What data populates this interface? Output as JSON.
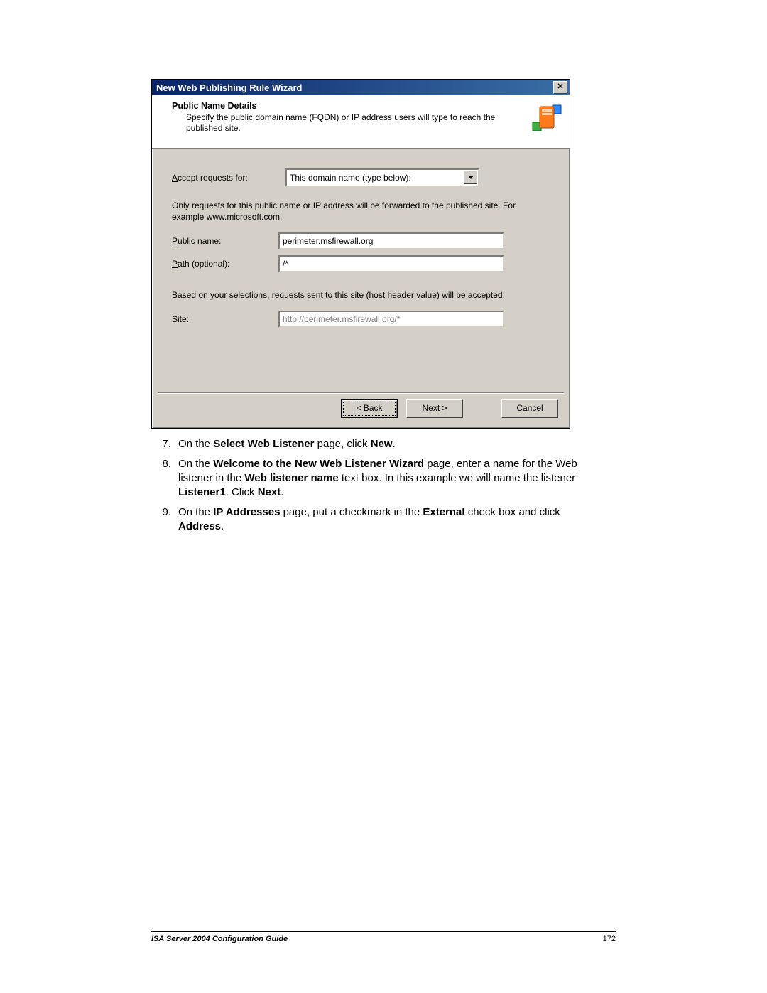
{
  "dialog": {
    "title": "New Web Publishing Rule Wizard",
    "close_x": "✕",
    "heading": "Public Name Details",
    "subhead": "Specify the public domain name (FQDN) or IP address users will type to reach the published site.",
    "accept_label": "Accept requests for:",
    "accept_value": "This domain name (type below):",
    "only_note": "Only requests for this public name or IP address will be forwarded to the published site. For example www.microsoft.com.",
    "public_label": "Public name:",
    "public_value": "perimeter.msfirewall.org",
    "path_label": "Path (optional):",
    "path_value": "/*",
    "based_note": "Based on your selections, requests sent to this site (host header value) will be accepted:",
    "site_label": "Site:",
    "site_value": "http://perimeter.msfirewall.org/*",
    "back_label": "< Back",
    "next_label": "Next >",
    "cancel_label": "Cancel"
  },
  "steps": {
    "s7": {
      "num": "7.",
      "pre": "On the ",
      "b1": "Select Web Listener",
      "mid": " page, click ",
      "b2": "New",
      "post": "."
    },
    "s8": {
      "num": "8.",
      "pre": "On the ",
      "b1": "Welcome to the New Web Listener Wizard",
      "mid": " page, enter a name for the Web listener in the ",
      "b2": "Web listener name",
      "mid2": " text box. In this example we will name the listener ",
      "b3": "Listener1",
      "post": ". Click ",
      "b4": "Next",
      "post2": "."
    },
    "s9": {
      "num": "9.",
      "pre": "On the ",
      "b1": "IP Addresses",
      "mid": " page, put a checkmark in the ",
      "b2": "External",
      "mid2": " check box and click ",
      "b3": "Address",
      "post": "."
    }
  },
  "footer": {
    "title": "ISA Server 2004 Configuration Guide",
    "page": "172"
  }
}
